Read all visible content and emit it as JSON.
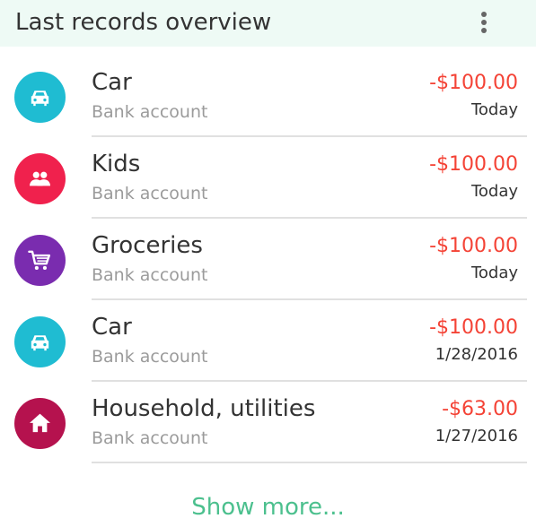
{
  "header": {
    "title": "Last records overview",
    "menu_icon": "more-vert-icon"
  },
  "records": [
    {
      "category": "Car",
      "account": "Bank account",
      "amount": "-$100.00",
      "date": "Today",
      "icon": "car-icon",
      "color": "#1fbcd2"
    },
    {
      "category": "Kids",
      "account": "Bank account",
      "amount": "-$100.00",
      "date": "Today",
      "icon": "kids-icon",
      "color": "#f0214d"
    },
    {
      "category": "Groceries",
      "account": "Bank account",
      "amount": "-$100.00",
      "date": "Today",
      "icon": "shopping-cart-icon",
      "color": "#7a2caf"
    },
    {
      "category": "Car",
      "account": "Bank account",
      "amount": "-$100.00",
      "date": "1/28/2016",
      "icon": "car-icon",
      "color": "#1fbcd2"
    },
    {
      "category": "Household, utilities",
      "account": "Bank account",
      "amount": "-$63.00",
      "date": "1/27/2016",
      "icon": "house-icon",
      "color": "#b5124e"
    }
  ],
  "footer": {
    "show_more_label": "Show more..."
  },
  "colors": {
    "header_bg": "#eefaf5",
    "amount_negative": "#f44336",
    "accent": "#4cc08e",
    "secondary_text": "#9b9b9b"
  }
}
